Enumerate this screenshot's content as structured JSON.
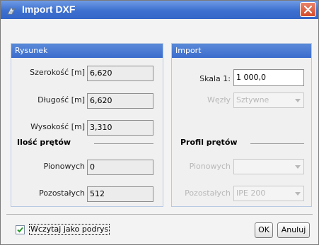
{
  "window": {
    "title": "Import DXF"
  },
  "rysunek": {
    "header": "Rysunek",
    "szerokosc": {
      "label": "Szerokość [m]",
      "value": "6,620"
    },
    "dlugosc": {
      "label": "Długość [m]",
      "value": "6,620"
    },
    "wysokosc": {
      "label": "Wysokość [m]",
      "value": "3,310"
    },
    "section": "Ilość prętów",
    "pionowych": {
      "label": "Pionowych",
      "value": "0"
    },
    "pozostalych": {
      "label": "Pozostałych",
      "value": "512"
    }
  },
  "import": {
    "header": "Import",
    "skala": {
      "label": "Skala 1:",
      "value": "1 000,0"
    },
    "wezly": {
      "label": "Węzły",
      "value": "Sztywne"
    },
    "section": "Profil prętów",
    "pionowych": {
      "label": "Pionowych",
      "value": ""
    },
    "pozostalych": {
      "label": "Pozostałych",
      "value": "IPE 200"
    }
  },
  "footer": {
    "checkbox_label": "Wczytaj jako podrys",
    "checkbox_checked": true,
    "ok_label": "OK",
    "cancel_label": "Anuluj"
  },
  "colors": {
    "titlebar": "#3c6fcf",
    "panel_header": "#4a7bd3",
    "close": "#d34b2a",
    "check": "#2a9a2a"
  },
  "icons": {
    "title": "dxf-import-icon",
    "close": "close-icon",
    "check": "checkmark-icon",
    "dropdown": "chevron-down-icon"
  }
}
